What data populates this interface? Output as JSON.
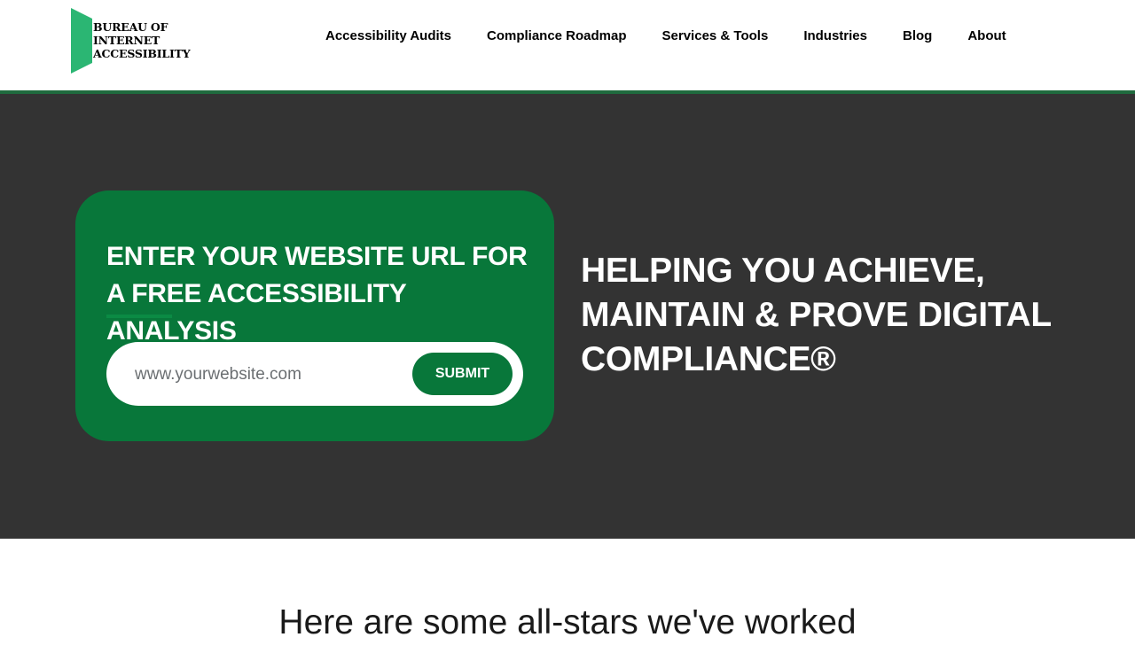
{
  "header": {
    "logo": {
      "line1": "BUREAU OF",
      "line2": "INTERNET",
      "line3": "ACCESSIBILITY"
    },
    "nav": [
      {
        "label": "Accessibility Audits"
      },
      {
        "label": "Compliance Roadmap"
      },
      {
        "label": "Services & Tools"
      },
      {
        "label": "Industries"
      },
      {
        "label": "Blog"
      },
      {
        "label": "About"
      }
    ]
  },
  "hero": {
    "card": {
      "title": "ENTER YOUR WEBSITE URL FOR A FREE ACCESSIBILITY ANALYSIS",
      "input_placeholder": "www.yourwebsite.com",
      "input_value": "",
      "submit_label": "SUBMIT"
    },
    "heading": "HELPING YOU ACHIEVE, MAINTAIN & PROVE DIGITAL COMPLIANCE®"
  },
  "clients": {
    "heading": "Here are some all-stars we've worked"
  },
  "colors": {
    "brand_green": "#08773a",
    "logo_green": "#2bb673",
    "hero_background": "#333333",
    "header_border": "#1f6b3e"
  },
  "icons": {
    "logo_mark": "green-flag-shape"
  }
}
